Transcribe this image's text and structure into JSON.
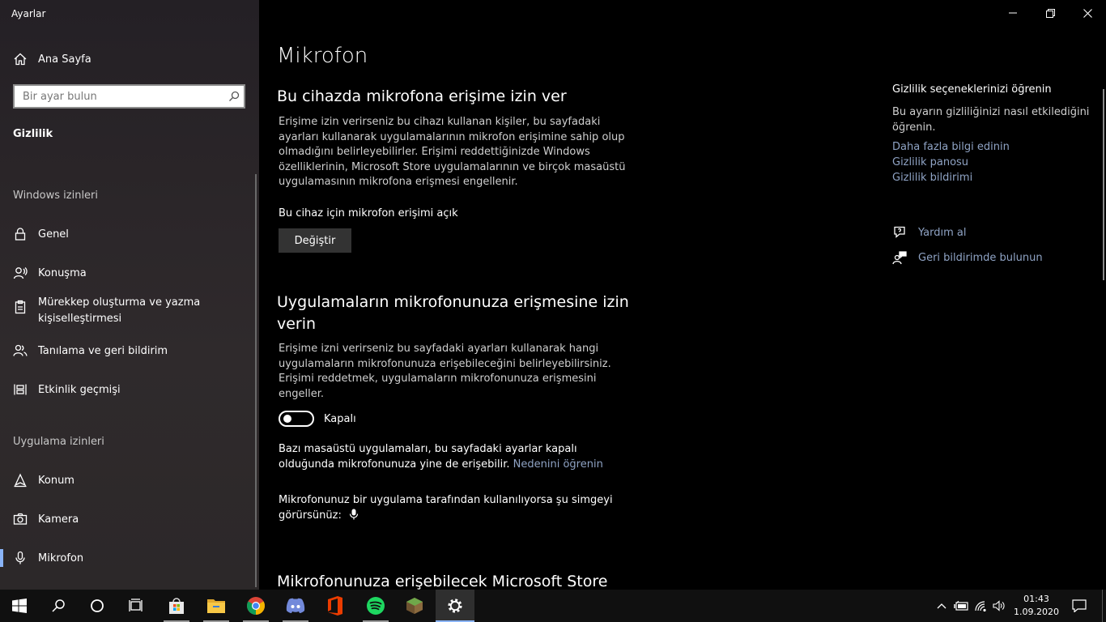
{
  "window": {
    "title": "Ayarlar"
  },
  "sidebar": {
    "home_label": "Ana Sayfa",
    "search_placeholder": "Bir ayar bulun",
    "category": "Gizlilik",
    "section_windows": "Windows izinleri",
    "windows_items": [
      {
        "label": "Genel",
        "icon": "lock-icon"
      },
      {
        "label": "Konuşma",
        "icon": "speech-icon"
      },
      {
        "label": "Mürekkep oluşturma ve yazma kişiselleştirmesi",
        "icon": "clipboard-icon"
      },
      {
        "label": "Tanılama ve geri bildirim",
        "icon": "people-icon"
      },
      {
        "label": "Etkinlik geçmişi",
        "icon": "timeline-icon"
      }
    ],
    "section_apps": "Uygulama izinleri",
    "app_items": [
      {
        "label": "Konum",
        "icon": "location-icon"
      },
      {
        "label": "Kamera",
        "icon": "camera-icon"
      },
      {
        "label": "Mikrofon",
        "icon": "microphone-icon",
        "selected": true
      }
    ]
  },
  "main": {
    "title": "Mikrofon",
    "device_heading": "Bu cihazda mikrofona erişime izin ver",
    "device_desc": "Erişime izin verirseniz bu cihazı kullanan kişiler, bu sayfadaki ayarları kullanarak uygulamalarının mikrofon erişimine sahip olup olmadığını belirleyebilirler. Erişimi reddettiğinizde Windows özelliklerinin, Microsoft Store uygulamalarının ve birçok masaüstü uygulamasının mikrofona erişmesi engellenir.",
    "device_status": "Bu cihaz için mikrofon erişimi açık",
    "change_button": "Değiştir",
    "apps_heading": "Uygulamaların mikrofonunuza erişmesine izin verin",
    "apps_desc": "Erişime izni verirseniz bu sayfadaki ayarları kullanarak hangi uygulamaların mikrofonunuza erişebileceğini belirleyebilirsiniz. Erişimi reddetmek, uygulamaların mikrofonunuza erişmesini engeller.",
    "toggle_state": "Kapalı",
    "toggle_on": false,
    "desktop_note": "Bazı masaüstü uygulamaları, bu sayfadaki ayarlar kapalı olduğunda mikrofonunuza yine de erişebilir.",
    "desktop_note_link": "Nedenini öğrenin",
    "icon_note": "Mikrofonunuz bir uygulama tarafından kullanılıyorsa şu simgeyi görürsünüz:",
    "store_heading": "Mikrofonunuza erişebilecek Microsoft Store"
  },
  "right": {
    "title": "Gizlilik seçeneklerinizi öğrenin",
    "desc": "Bu ayarın gizliliğinizi nasıl etkilediğini öğrenin.",
    "links": [
      "Daha fazla bilgi edinin",
      "Gizlilik panosu",
      "Gizlilik bildirimi"
    ],
    "help": "Yardım al",
    "feedback": "Geri bildirimde bulunun"
  },
  "taskbar": {
    "apps": [
      "start-icon",
      "search-icon",
      "cortana-icon",
      "task-view-icon",
      "store-icon",
      "file-explorer-icon",
      "chrome-icon",
      "discord-icon",
      "office-icon",
      "spotify-icon",
      "minecraft-icon",
      "settings-icon"
    ],
    "time": "01:43",
    "date": "1.09.2020"
  },
  "colors": {
    "accent": "#8ab4f8",
    "link": "#8fa3c4",
    "sidebar_bg": "#2b2629"
  }
}
